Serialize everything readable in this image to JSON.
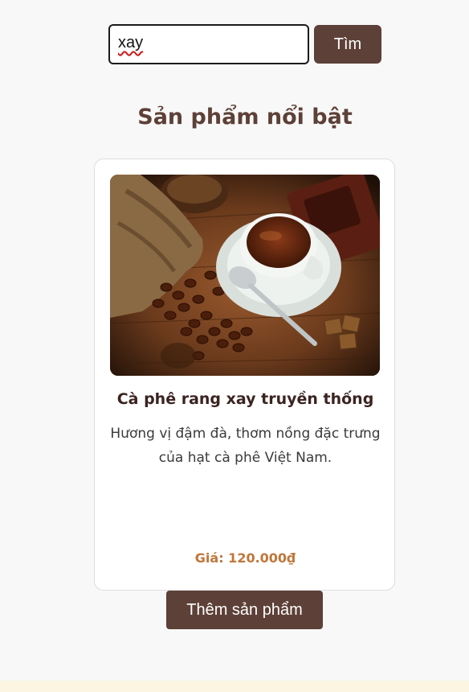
{
  "search": {
    "value": "xay",
    "button_label": "Tìm"
  },
  "section": {
    "title": "Sản phẩm nổi bật"
  },
  "product": {
    "image_alt": "coffee cup with roasted coffee beans",
    "name": "Cà phê rang xay truyền thống",
    "description": "Hương vị đậm đà, thơm nồng đặc trưng của hạt cà phê Việt Nam.",
    "price": "Giá: 120.000₫"
  },
  "actions": {
    "add_product_label": "Thêm sản phẩm"
  },
  "colors": {
    "primary": "#5d4037",
    "price": "#c0763a",
    "background": "#f8f8f8"
  }
}
